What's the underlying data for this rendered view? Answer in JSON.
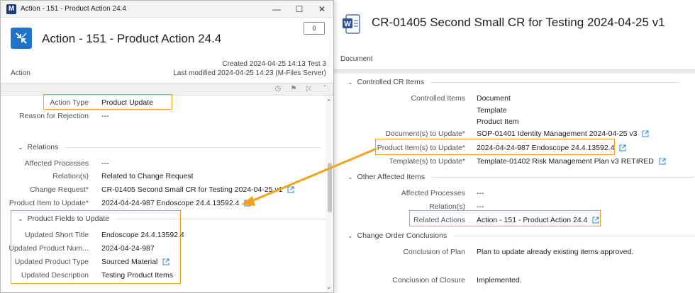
{
  "window": {
    "title": "Action - 151 - Product Action 24.4"
  },
  "object": {
    "title": "Action - 151 - Product Action 24.4",
    "class": "Action",
    "comments_count": "0",
    "created": "Created 2024-04-25 14:13 Test 3",
    "modified": "Last modified 2024-04-25 14:23 (M-Files Server)"
  },
  "left_props": {
    "action_type_label": "Action Type",
    "action_type_value": "Product Update",
    "rejection_label": "Reason for Rejection",
    "rejection_value": "---",
    "relations_section": "Relations",
    "affected_processes_label": "Affected Processes",
    "affected_processes_value": "---",
    "relations_label": "Relation(s)",
    "relations_value": "Related to Change Request",
    "change_request_label": "Change Request",
    "change_request_value": "CR-01405 Second Small CR for Testing 2024-04-25 v1",
    "product_item_label": "Product Item to Update",
    "product_item_value": "2024-04-24-987 Endoscope 24.4.13592.4",
    "product_fields_section": "Product Fields to Update",
    "short_title_label": "Updated Short Title",
    "short_title_value": "Endoscope 24.4.13592.4",
    "product_number_label": "Updated Product Num...",
    "product_number_value": "2024-04-24-987",
    "product_type_label": "Updated Product Type",
    "product_type_value": "Sourced Material",
    "description_label": "Updated Description",
    "description_value": "Testing Product Items"
  },
  "document": {
    "title": "CR-01405 Second Small CR for Testing 2024-04-25 v1",
    "type": "Document"
  },
  "right_props": {
    "controlled_section": "Controlled CR Items",
    "controlled_items_label": "Controlled Items",
    "controlled_items": [
      "Document",
      "Template",
      "Product Item"
    ],
    "documents_label": "Document(s) to Update",
    "documents_value": "SOP-01401 Identity Management 2024-04-25 v3",
    "product_items_label": "Product Item(s) to Update",
    "product_items_value": "2024-04-24-987 Endoscope 24.4.13592.4",
    "templates_label": "Template(s) to Update",
    "templates_value": "Template-01402 Risk Management Plan v3 RETIRED",
    "other_section": "Other Affected Items",
    "affected_processes_label": "Affected Processes",
    "affected_processes_value": "---",
    "relations_label": "Relation(s)",
    "relations_value": "---",
    "related_actions_label": "Related Actions",
    "related_actions_value": "Action - 151 - Product Action 24.4",
    "conclusions_section": "Change Order Conclusions",
    "plan_label": "Conclusion of Plan",
    "plan_value": "Plan to update already existing items approved.",
    "closure_label": "Conclusion of Closure",
    "closure_value": "Implemented."
  },
  "colors": {
    "highlight": "#f2a31b",
    "link_icon": "#2f7fd0",
    "accent": "#1f73c9"
  }
}
